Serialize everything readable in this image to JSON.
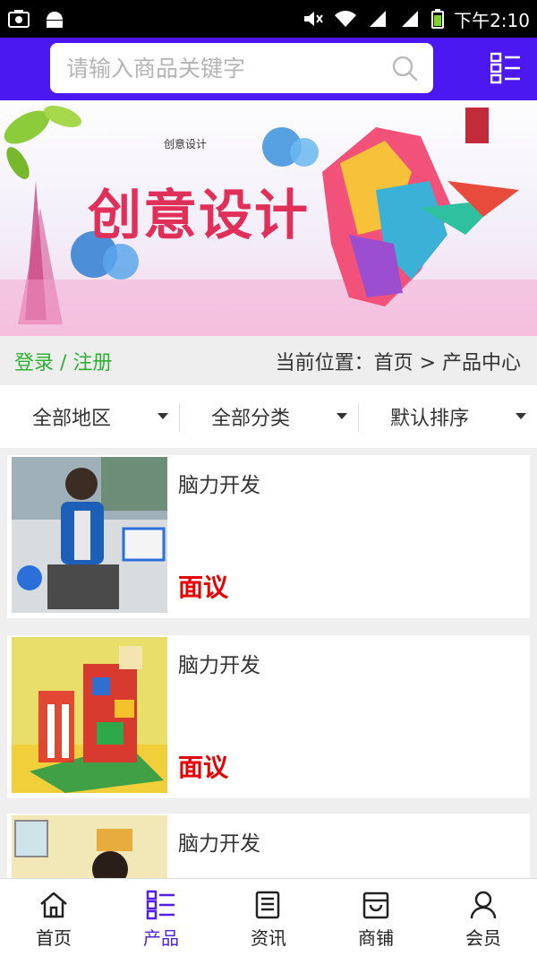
{
  "status_bar": {
    "time": "下午2:10"
  },
  "header": {
    "search_placeholder": "请输入商品关键字"
  },
  "banner": {
    "title": "创意设计",
    "logo_text": "创意设计"
  },
  "location_bar": {
    "login_text": "登录 / 注册",
    "breadcrumb": "当前位置：首页 > 产品中心"
  },
  "filters": [
    {
      "label": "全部地区"
    },
    {
      "label": "全部分类"
    },
    {
      "label": "默认排序"
    }
  ],
  "products": [
    {
      "name": "脑力开发",
      "price": "面议"
    },
    {
      "name": "脑力开发",
      "price": "面议"
    },
    {
      "name": "脑力开发",
      "price": ""
    }
  ],
  "tabbar": [
    {
      "label": "首页",
      "icon": "home-icon"
    },
    {
      "label": "产品",
      "icon": "list-icon",
      "active": true
    },
    {
      "label": "资讯",
      "icon": "news-icon"
    },
    {
      "label": "商铺",
      "icon": "store-icon"
    },
    {
      "label": "会员",
      "icon": "user-icon"
    }
  ],
  "colors": {
    "header": "#4b18f2",
    "login": "#2db132",
    "price": "#e60000",
    "active_tab": "#5420e8"
  }
}
